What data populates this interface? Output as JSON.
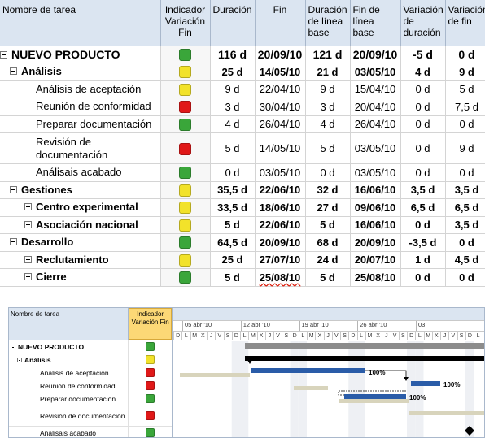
{
  "table": {
    "headers": [
      "Nombre de tarea",
      "Indicador Variación Fin",
      "Duración",
      "Fin",
      "Duración de línea base",
      "Fin de línea base",
      "Variación de duración",
      "Variación de fin"
    ],
    "rows": [
      {
        "name": "NUEVO PRODUCTO",
        "status": "green",
        "duration": "116 d",
        "finish": "20/09/10",
        "baseline_duration": "121 d",
        "baseline_finish": "20/09/10",
        "duration_variance": "-5 d",
        "finish_variance": "0 d"
      },
      {
        "name": "Análisis",
        "status": "yellow",
        "duration": "25 d",
        "finish": "14/05/10",
        "baseline_duration": "21 d",
        "baseline_finish": "03/05/10",
        "duration_variance": "4 d",
        "finish_variance": "9 d"
      },
      {
        "name": "Análisis de aceptación",
        "status": "yellow",
        "duration": "9 d",
        "finish": "22/04/10",
        "baseline_duration": "9 d",
        "baseline_finish": "15/04/10",
        "duration_variance": "0 d",
        "finish_variance": "5 d"
      },
      {
        "name": "Reunión de conformidad",
        "status": "red",
        "duration": "3 d",
        "finish": "30/04/10",
        "baseline_duration": "3 d",
        "baseline_finish": "20/04/10",
        "duration_variance": "0 d",
        "finish_variance": "7,5 d"
      },
      {
        "name": "Preparar documentación",
        "status": "green",
        "duration": "4 d",
        "finish": "26/04/10",
        "baseline_duration": "4 d",
        "baseline_finish": "26/04/10",
        "duration_variance": "0 d",
        "finish_variance": "0 d"
      },
      {
        "name": "Revisión de documentación",
        "status": "red",
        "duration": "5 d",
        "finish": "14/05/10",
        "baseline_duration": "5 d",
        "baseline_finish": "03/05/10",
        "duration_variance": "0 d",
        "finish_variance": "9 d"
      },
      {
        "name": "Análisais acabado",
        "status": "green",
        "duration": "0 d",
        "finish": "03/05/10",
        "baseline_duration": "0 d",
        "baseline_finish": "03/05/10",
        "duration_variance": "0 d",
        "finish_variance": "0 d"
      },
      {
        "name": "Gestiones",
        "status": "yellow",
        "duration": "35,5 d",
        "finish": "22/06/10",
        "baseline_duration": "32 d",
        "baseline_finish": "16/06/10",
        "duration_variance": "3,5 d",
        "finish_variance": "3,5 d"
      },
      {
        "name": "Centro experimental",
        "status": "yellow",
        "duration": "33,5 d",
        "finish": "18/06/10",
        "baseline_duration": "27 d",
        "baseline_finish": "09/06/10",
        "duration_variance": "6,5 d",
        "finish_variance": "6,5 d"
      },
      {
        "name": "Asociación nacional",
        "status": "yellow",
        "duration": "5 d",
        "finish": "22/06/10",
        "baseline_duration": "5 d",
        "baseline_finish": "16/06/10",
        "duration_variance": "0 d",
        "finish_variance": "3,5 d"
      },
      {
        "name": "Desarrollo",
        "status": "green",
        "duration": "64,5 d",
        "finish": "20/09/10",
        "baseline_duration": "68 d",
        "baseline_finish": "20/09/10",
        "duration_variance": "-3,5 d",
        "finish_variance": "0 d"
      },
      {
        "name": "Reclutamiento",
        "status": "yellow",
        "duration": "25 d",
        "finish": "27/07/10",
        "baseline_duration": "24 d",
        "baseline_finish": "20/07/10",
        "duration_variance": "1 d",
        "finish_variance": "4,5 d"
      },
      {
        "name": "Cierre",
        "status": "green",
        "duration": "5 d",
        "finish": "25/08/10",
        "baseline_duration": "5 d",
        "baseline_finish": "25/08/10",
        "duration_variance": "0 d",
        "finish_variance": "0 d"
      }
    ]
  },
  "gantt": {
    "header_name": "Nombre de tarea",
    "header_indicator": "Indicador Variación Fin",
    "weeks": [
      "05 abr '10",
      "12 abr '10",
      "19 abr '10",
      "26 abr '10",
      "03"
    ],
    "day_letters": [
      "D",
      "L",
      "M",
      "X",
      "J",
      "V",
      "S",
      "D",
      "L",
      "M",
      "X",
      "J",
      "V",
      "S",
      "D",
      "L",
      "M",
      "X",
      "J",
      "V",
      "S",
      "D",
      "L",
      "M",
      "X",
      "J",
      "V",
      "S",
      "D",
      "L",
      "M",
      "X",
      "J",
      "V",
      "S",
      "D",
      "L"
    ],
    "rows": [
      {
        "name": "NUEVO PRODUCTO",
        "status": "green"
      },
      {
        "name": "Análisis",
        "status": "yellow"
      },
      {
        "name": "Análisis de aceptación",
        "status": "red"
      },
      {
        "name": "Reunión de conformidad",
        "status": "red"
      },
      {
        "name": "Preparar documentación",
        "status": "green"
      },
      {
        "name": "Revisión de documentación",
        "status": "red"
      },
      {
        "name": "Análisais acabado",
        "status": "green"
      }
    ],
    "percent_labels": [
      "100%",
      "100%",
      "100%"
    ]
  },
  "colors": {
    "green": "#3aa63a",
    "yellow": "#f2e22a",
    "red": "#e01818",
    "task_bar": "#2a5ca8",
    "baseline_bar": "#d8d4bc",
    "summary_bar": "#000000"
  }
}
